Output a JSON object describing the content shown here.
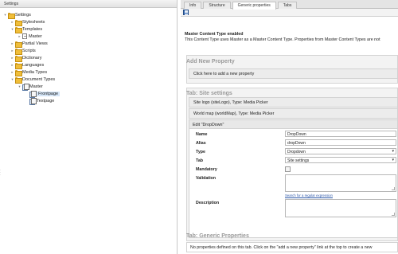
{
  "left_panel": {
    "header": "Settings",
    "tree": [
      {
        "label": "Settings",
        "icon": "folder-icon",
        "arrow": "▾",
        "level": 0
      },
      {
        "label": "Stylesheets",
        "icon": "folder-icon",
        "arrow": "▸",
        "level": 1
      },
      {
        "label": "Templates",
        "icon": "folder-icon",
        "arrow": "▾",
        "level": 1
      },
      {
        "label": "Master",
        "icon": "document-icon",
        "arrow": "▸",
        "level": 2
      },
      {
        "label": "Partial Views",
        "icon": "folder-icon",
        "arrow": "▸",
        "level": 1
      },
      {
        "label": "Scripts",
        "icon": "folder-icon",
        "arrow": "▸",
        "level": 1
      },
      {
        "label": "Dictionary",
        "icon": "folder-icon",
        "arrow": "▸",
        "level": 1
      },
      {
        "label": "Languages",
        "icon": "folder-icon",
        "arrow": "▸",
        "level": 1
      },
      {
        "label": "Media Types",
        "icon": "folder-icon",
        "arrow": "▸",
        "level": 1
      },
      {
        "label": "Document Types",
        "icon": "folder-icon",
        "arrow": "▾",
        "level": 1
      },
      {
        "label": "Master",
        "icon": "document-type-icon",
        "arrow": "▾",
        "level": 2
      },
      {
        "label": "Frontpage",
        "icon": "document-type-icon",
        "arrow": "",
        "level": 3,
        "selected": true
      },
      {
        "label": "Textpage",
        "icon": "document-type-icon",
        "arrow": "",
        "level": 3
      }
    ]
  },
  "tabs": [
    {
      "label": "Info",
      "active": false
    },
    {
      "label": "Structure",
      "active": false
    },
    {
      "label": "Generic properties",
      "active": true
    },
    {
      "label": "Tabs",
      "active": false
    }
  ],
  "toolbar": {
    "save_icon": "save-icon"
  },
  "master_info": {
    "title": "Master Content Type enabled",
    "text": "This Content Type uses Master as a Master Content Type. Properties from Master Content Types are not"
  },
  "add_property": {
    "title": "Add New Property",
    "link": "Click here to add a new property"
  },
  "site_settings": {
    "title": "Tab: Site settings",
    "rows": [
      "Site logo (siteLogo), Type: Media Picker",
      "World map (worldMap), Type: Media Picker"
    ]
  },
  "edit_property": {
    "header": "Edit \"DropDown\"",
    "name_label": "Name",
    "name_value": "DropDown",
    "alias_label": "Alias",
    "alias_value": "dropDown",
    "type_label": "Type",
    "type_value": "Dropdown",
    "tab_label": "Tab",
    "tab_value": "Site settings",
    "mandatory_label": "Mandatory",
    "validation_label": "Validation",
    "regex_link": "Search for a regular expression",
    "description_label": "Description"
  },
  "generic_properties": {
    "title": "Tab: Generic Properties",
    "empty_text": "No properties defined on this tab. Click on the \"add a new property\" link at the top to create a new"
  }
}
